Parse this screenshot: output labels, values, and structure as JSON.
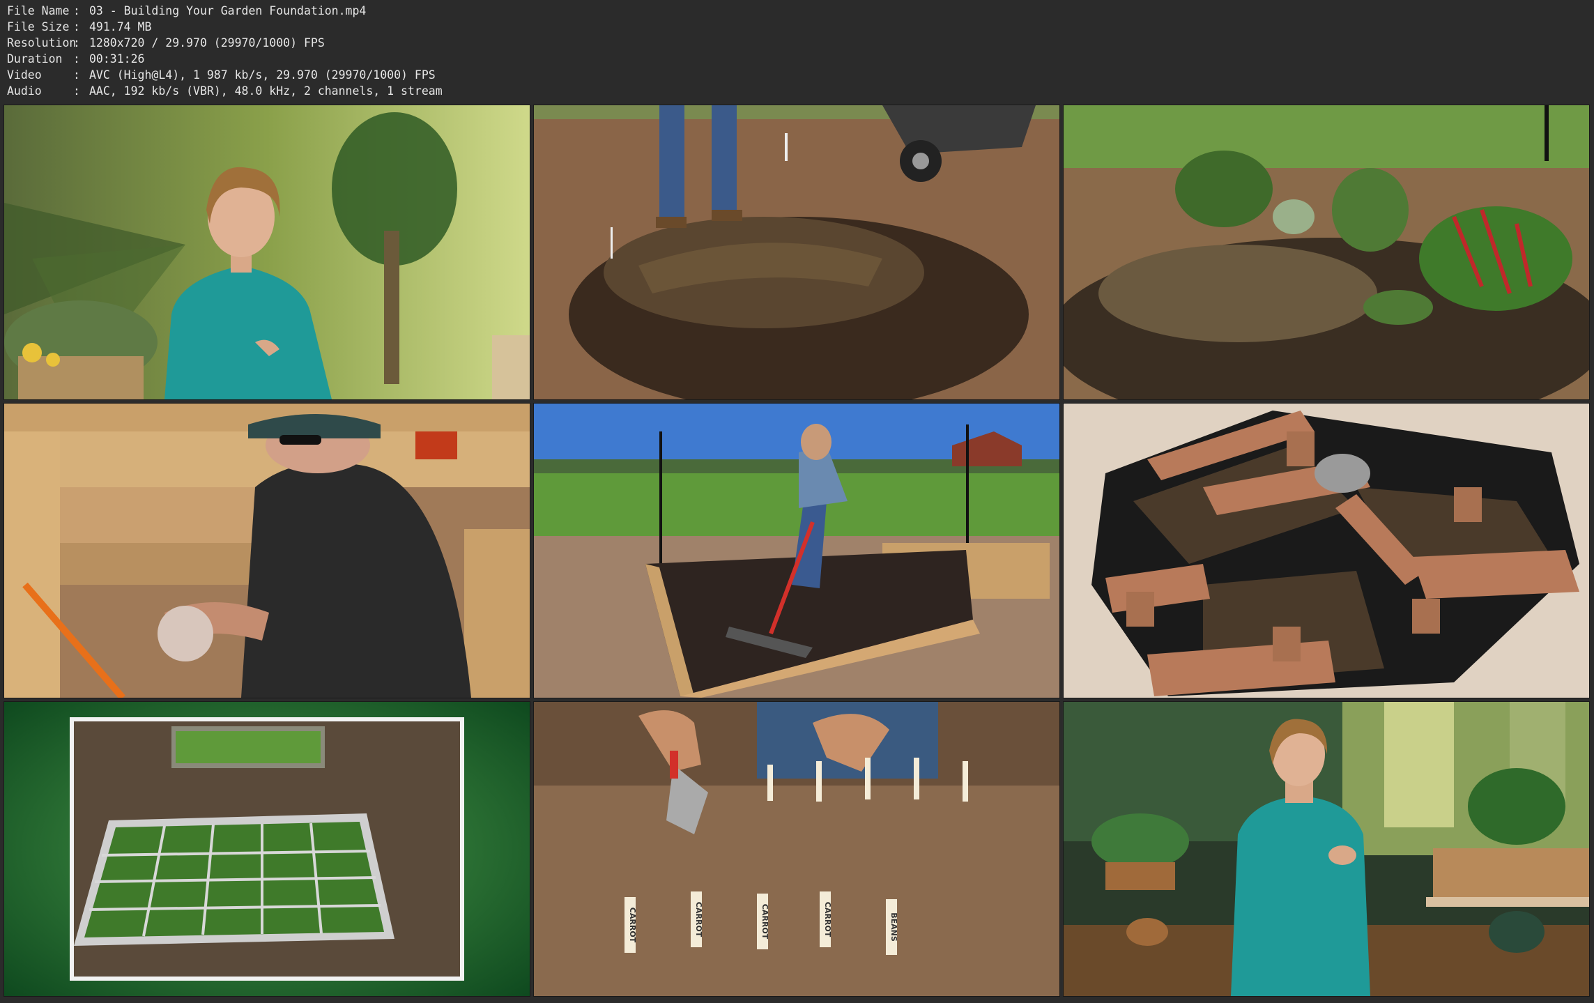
{
  "info": [
    {
      "key": "File Name",
      "value": "03 - Building Your Garden Foundation.mp4"
    },
    {
      "key": "File Size",
      "value": "491.74 MB"
    },
    {
      "key": "Resolution",
      "value": "1280x720 / 29.970 (29970/1000) FPS"
    },
    {
      "key": "Duration",
      "value": "00:31:26"
    },
    {
      "key": "Video",
      "value": "AVC (High@L4), 1 987 kb/s, 29.970 (29970/1000) FPS"
    },
    {
      "key": "Audio",
      "value": "AAC, 192 kb/s (VBR), 48.0 kHz, 2 channels, 1 stream"
    }
  ],
  "separator": ":",
  "stake_labels": [
    "CARROT",
    "CARROT",
    "CARROT",
    "CARROT",
    "BEANS"
  ],
  "colors": {
    "background": "#2b2b2b",
    "text": "#e6e6e6",
    "shirt_teal": "#1f9a98",
    "soil": "#5a3e2b",
    "wood": "#c9a06a",
    "grass": "#5f8f3a"
  }
}
